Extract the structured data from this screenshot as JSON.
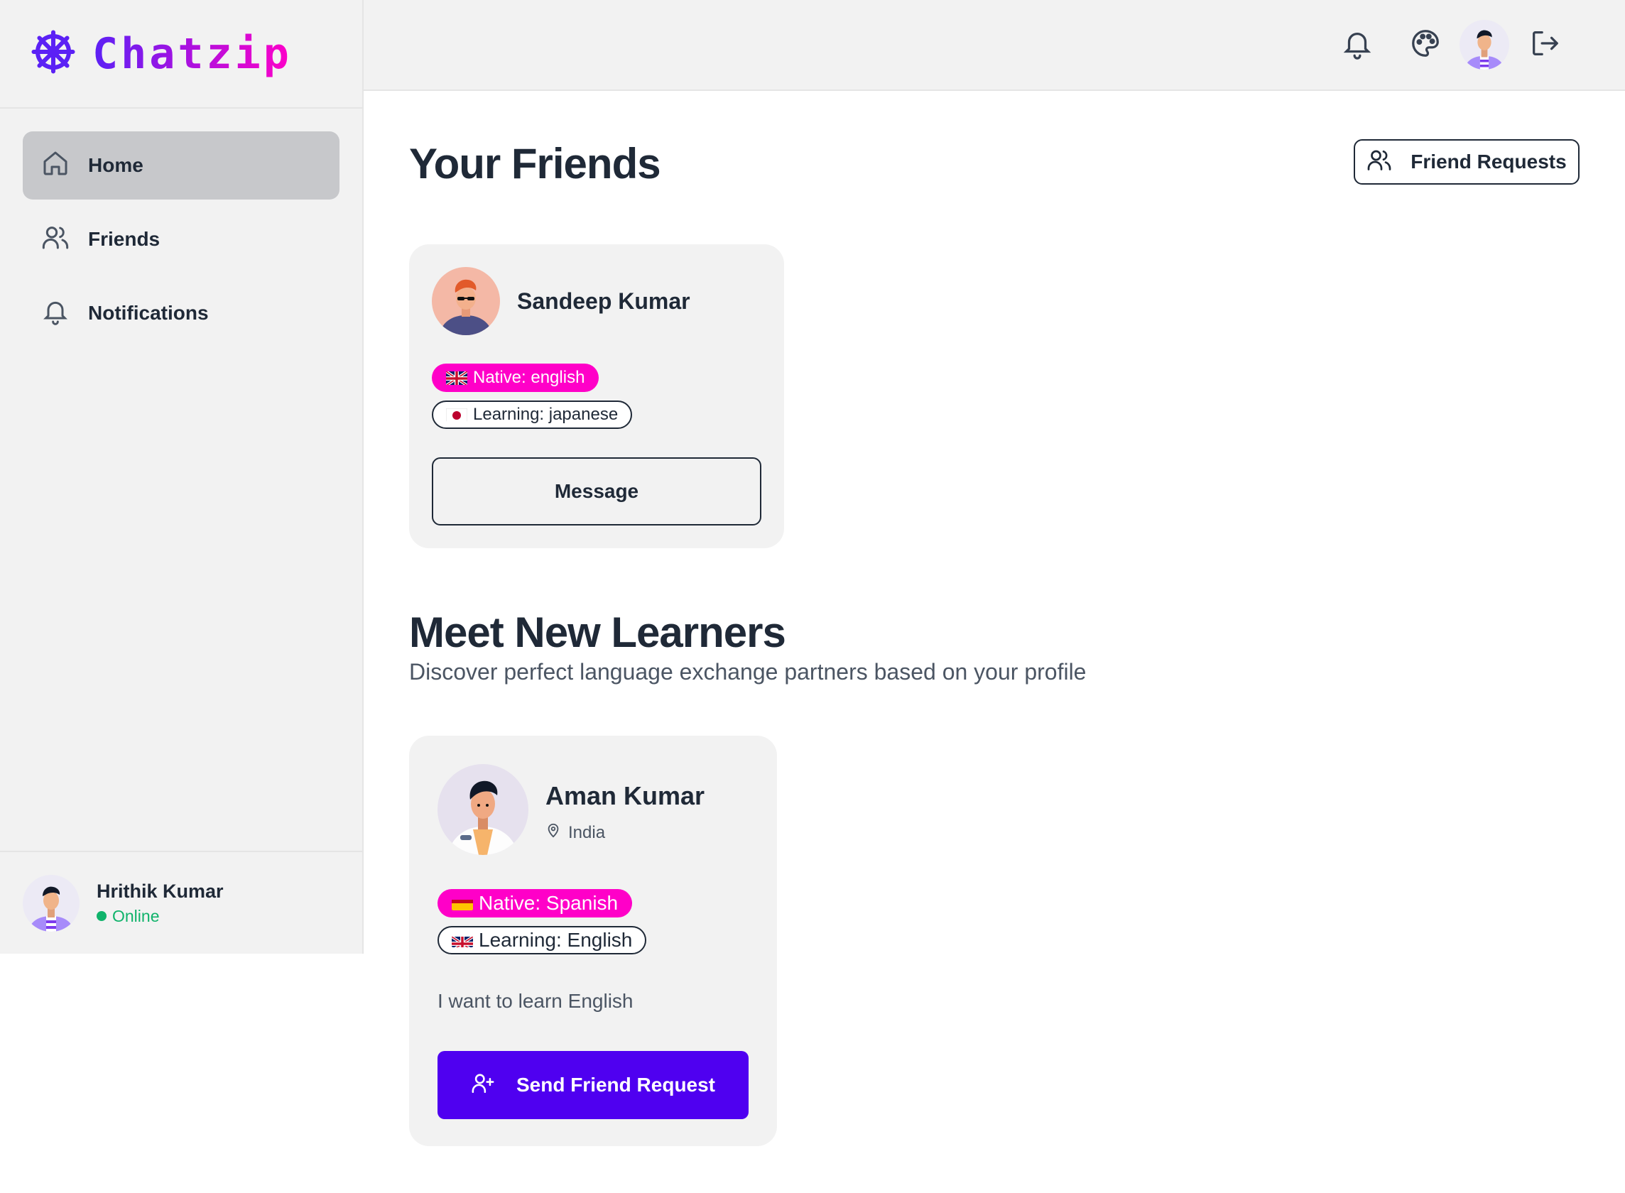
{
  "brand": {
    "name": "Chatzip",
    "icon": "ship-wheel-icon"
  },
  "sidebar": {
    "items": [
      {
        "label": "Home",
        "icon": "home-icon",
        "active": true
      },
      {
        "label": "Friends",
        "icon": "users-icon",
        "active": false
      },
      {
        "label": "Notifications",
        "icon": "bell-icon",
        "active": false
      }
    ],
    "user": {
      "name": "Hrithik Kumar",
      "status": "Online"
    }
  },
  "header": {
    "icons": [
      "bell-icon",
      "palette-icon",
      "avatar",
      "logout-icon"
    ]
  },
  "friends_section": {
    "title": "Your Friends",
    "requests_button": "Friend Requests",
    "friends": [
      {
        "name": "Sandeep Kumar",
        "native": "Native: english",
        "learning": "Learning: japanese",
        "action": "Message"
      }
    ]
  },
  "learners_section": {
    "title": "Meet New Learners",
    "subtitle": "Discover perfect language exchange partners based on your profile",
    "learners": [
      {
        "name": "Aman Kumar",
        "location": "India",
        "native": "Native: Spanish",
        "learning": "Learning: English",
        "bio": "I want to learn English",
        "action": "Send Friend Request"
      }
    ]
  },
  "colors": {
    "accent": "#4f00f0",
    "pink": "#ff00c8",
    "online": "#10b36b",
    "sidebar_bg": "#f2f2f2"
  }
}
